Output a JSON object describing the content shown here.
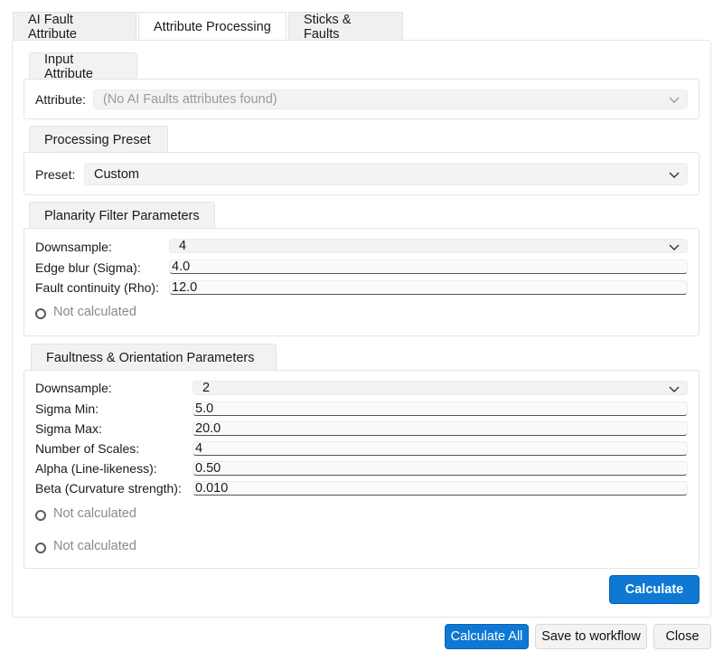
{
  "tabs": [
    "AI Fault Attribute",
    "Attribute Processing",
    "Sticks & Faults"
  ],
  "input_attribute": {
    "title": "Input Attribute",
    "label": "Attribute:",
    "value": "(No AI Faults attributes found)"
  },
  "processing_preset": {
    "title": "Processing Preset",
    "label": "Preset:",
    "value": "Custom"
  },
  "planarity": {
    "title": "Planarity Filter Parameters",
    "downsample_label": "Downsample:",
    "downsample_value": "4",
    "edge_blur_label": "Edge blur (Sigma):",
    "edge_blur_value": "4.0",
    "continuity_label": "Fault continuity (Rho):",
    "continuity_value": "12.0",
    "status": "Not calculated"
  },
  "faultness": {
    "title": "Faultness & Orientation Parameters",
    "downsample_label": "Downsample:",
    "downsample_value": "2",
    "sigma_min_label": "Sigma Min:",
    "sigma_min_value": "5.0",
    "sigma_max_label": "Sigma Max:",
    "sigma_max_value": "20.0",
    "scales_label": "Number of Scales:",
    "scales_value": "4",
    "alpha_label": "Alpha (Line-likeness):",
    "alpha_value": "0.50",
    "beta_label": "Beta (Curvature strength):",
    "beta_value": "0.010",
    "status1": "Not calculated",
    "status2": "Not calculated"
  },
  "buttons": {
    "calculate": "Calculate",
    "calculate_all": "Calculate All",
    "save_to_workflow": "Save to workflow",
    "close": "Close"
  },
  "colors": {
    "accent": "#0f78d4"
  }
}
